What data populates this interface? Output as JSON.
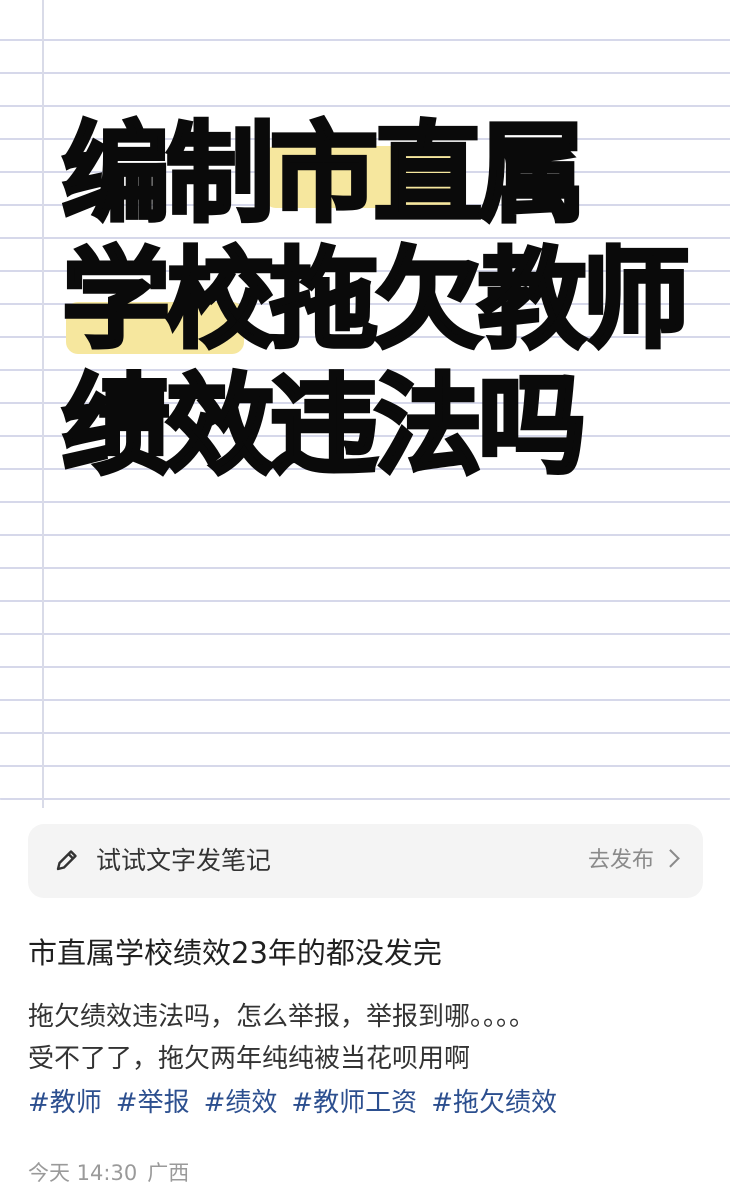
{
  "note_card": {
    "title_lines": [
      {
        "segments": [
          "编制",
          "市直",
          "属"
        ]
      },
      {
        "segments": [
          "学校",
          "拖欠教师"
        ]
      },
      {
        "segments": [
          "绩效违法吗"
        ]
      }
    ],
    "highlight_color": "#f6e79e",
    "line_color": "#d6d8ea"
  },
  "prompt_bar": {
    "icon": "pencil-icon",
    "text": "试试文字发笔记",
    "publish_label": "去发布",
    "publish_icon": "chevron-right-icon"
  },
  "post": {
    "title": "市直属学校绩效23年的都没发完",
    "body_lines": [
      "拖欠绩效违法吗，怎么举报，举报到哪。。。。",
      "受不了了，拖欠两年纯纯被当花呗用啊"
    ],
    "tags": [
      "#教师",
      "#举报",
      "#绩效",
      "#教师工资",
      "#拖欠绩效"
    ],
    "tag_color": "#2c4f8f",
    "time": "今天 14:30",
    "location": "广西"
  }
}
